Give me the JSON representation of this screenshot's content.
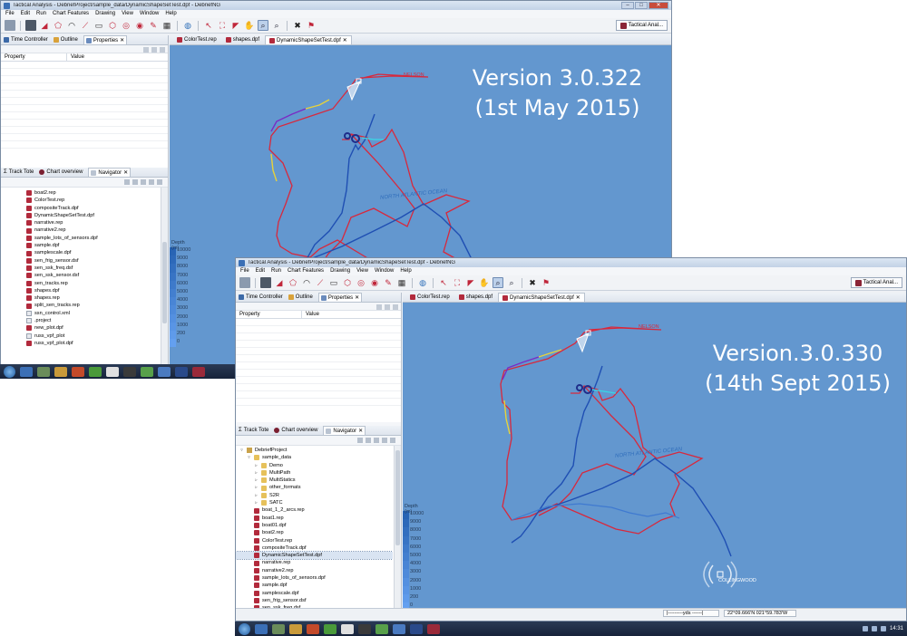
{
  "windows": [
    {
      "title": "Tactical Analysis - DebriefProject/sample_data/DynamicShapeSetTest.dpf - DebriefNG",
      "menu": [
        "File",
        "Edit",
        "Run",
        "Chart Features",
        "Drawing",
        "View",
        "Window",
        "Help"
      ],
      "perspective": "Tactical Anal...",
      "top_tabs": [
        "Time Controller",
        "Outline",
        "Properties"
      ],
      "props_headers": {
        "property": "Property",
        "value": "Value"
      },
      "bottom_tabs": [
        "Track Tote",
        "Chart overview",
        "Navigator"
      ],
      "editor_tabs": [
        "ColorTest.rep",
        "shapes.dpf",
        "DynamicShapeSetTest.dpf"
      ],
      "tree": [
        {
          "label": "boat2.rep",
          "kind": "file"
        },
        {
          "label": "ColorTest.rep",
          "kind": "file"
        },
        {
          "label": "compositeTrack.dpf",
          "kind": "file"
        },
        {
          "label": "DynamicShapeSetTest.dpf",
          "kind": "file"
        },
        {
          "label": "narrative.rep",
          "kind": "file"
        },
        {
          "label": "narrative2.rep",
          "kind": "file"
        },
        {
          "label": "sample_lots_of_sensors.dpf",
          "kind": "file"
        },
        {
          "label": "sample.dpf",
          "kind": "file"
        },
        {
          "label": "samplescale.dpf",
          "kind": "file"
        },
        {
          "label": "sen_frig_sensor.dsf",
          "kind": "file"
        },
        {
          "label": "sen_ssk_freq.dsf",
          "kind": "file"
        },
        {
          "label": "sen_ssk_sensor.dsf",
          "kind": "file"
        },
        {
          "label": "sen_tracks.rep",
          "kind": "file"
        },
        {
          "label": "shapes.dpf",
          "kind": "file"
        },
        {
          "label": "shapes.rep",
          "kind": "file"
        },
        {
          "label": "split_sen_tracks.rep",
          "kind": "file"
        },
        {
          "label": "ssn_control.xml",
          "kind": "plain"
        },
        {
          "label": ".project",
          "kind": "plain"
        },
        {
          "label": "new_plot.dpf",
          "kind": "file"
        },
        {
          "label": "russ_vpf_plot",
          "kind": "plain"
        },
        {
          "label": "russ_vpf_plot.dpf",
          "kind": "file"
        }
      ],
      "version_line1": "Version 3.0.322",
      "version_line2": "(1st May 2015)",
      "map_label_ship": "NELSON",
      "map_label_ocean": "NORTH ATLANTIC OCEAN",
      "depth_title": "Depth (m)",
      "depth_levels": [
        "10000",
        "9000",
        "8000",
        "7000",
        "6000",
        "5000",
        "4000",
        "3000",
        "2000",
        "1000",
        "200",
        "0"
      ],
      "taskbar_clock": ""
    },
    {
      "title": "Tactical Analysis - DebriefProject/sample_data/DynamicShapeSetTest.dpf - DebriefNG",
      "menu": [
        "File",
        "Edit",
        "Run",
        "Chart Features",
        "Drawing",
        "View",
        "Window",
        "Help"
      ],
      "perspective": "Tactical Anal...",
      "top_tabs": [
        "Time Controller",
        "Outline",
        "Properties"
      ],
      "props_headers": {
        "property": "Property",
        "value": "Value"
      },
      "bottom_tabs": [
        "Track Tote",
        "Chart overview",
        "Navigator"
      ],
      "editor_tabs": [
        "ColorTest.rep",
        "shapes.dpf",
        "DynamicShapeSetTest.dpf"
      ],
      "tree": [
        {
          "label": "DebriefProject",
          "kind": "proj",
          "indent": 0,
          "exp": "▿"
        },
        {
          "label": "sample_data",
          "kind": "folder",
          "indent": 1,
          "exp": "▿"
        },
        {
          "label": "Demo",
          "kind": "folder",
          "indent": 2,
          "exp": "▹"
        },
        {
          "label": "MultiPath",
          "kind": "folder",
          "indent": 2,
          "exp": "▹"
        },
        {
          "label": "MultiStatics",
          "kind": "folder",
          "indent": 2,
          "exp": "▹"
        },
        {
          "label": "other_formats",
          "kind": "folder",
          "indent": 2,
          "exp": "▹"
        },
        {
          "label": "S2R",
          "kind": "folder",
          "indent": 2,
          "exp": "▹"
        },
        {
          "label": "SATC",
          "kind": "folder",
          "indent": 2,
          "exp": "▹"
        },
        {
          "label": "boat_1_2_arcs.rep",
          "kind": "file",
          "indent": 2
        },
        {
          "label": "boat1.rep",
          "kind": "file",
          "indent": 2
        },
        {
          "label": "boat01.dpf",
          "kind": "file",
          "indent": 2
        },
        {
          "label": "boat2.rep",
          "kind": "file",
          "indent": 2
        },
        {
          "label": "ColorTest.rep",
          "kind": "file",
          "indent": 2
        },
        {
          "label": "compositeTrack.dpf",
          "kind": "file",
          "indent": 2
        },
        {
          "label": "DynamicShapeSetTest.dpf",
          "kind": "file",
          "indent": 2,
          "selected": true
        },
        {
          "label": "narrative.rep",
          "kind": "file",
          "indent": 2
        },
        {
          "label": "narrative2.rep",
          "kind": "file",
          "indent": 2
        },
        {
          "label": "sample_lots_of_sensors.dpf",
          "kind": "file",
          "indent": 2
        },
        {
          "label": "sample.dpf",
          "kind": "file",
          "indent": 2
        },
        {
          "label": "samplescale.dpf",
          "kind": "file",
          "indent": 2
        },
        {
          "label": "sen_frig_sensor.dsf",
          "kind": "file",
          "indent": 2
        },
        {
          "label": "sen_ssk_freq.dsf",
          "kind": "file",
          "indent": 2
        }
      ],
      "version_line1": "Version.3.0.330",
      "version_line2": "(14th Sept 2015)",
      "map_label_ship": "NELSON",
      "map_label_ship2": "COLLINGWOOD",
      "map_label_ocean": "NORTH ATLANTIC OCEAN",
      "depth_title": "Depth (m)",
      "depth_levels": [
        "10000",
        "9000",
        "8000",
        "7000",
        "6000",
        "5000",
        "4000",
        "3000",
        "2000",
        "1000",
        "200",
        "0"
      ],
      "status_scale": "|---------yds ------|",
      "status_coords": "22°09.666'N 021°59.783'W",
      "taskbar_clock": "14:31"
    }
  ],
  "colors": {
    "sea": "#6397cf",
    "track_red": "#d8283c",
    "track_blue": "#1f4fb3",
    "track_purple": "#7a2bc4",
    "track_yellow": "#e8d23a",
    "track_cyan": "#38d8e6"
  },
  "icons": [
    "save-icon",
    "print-icon",
    "select-icon",
    "zoom-icon",
    "pan-icon",
    "fit-icon",
    "globe-icon",
    "ruler-icon",
    "rotate-icon",
    "close-cross-icon"
  ]
}
